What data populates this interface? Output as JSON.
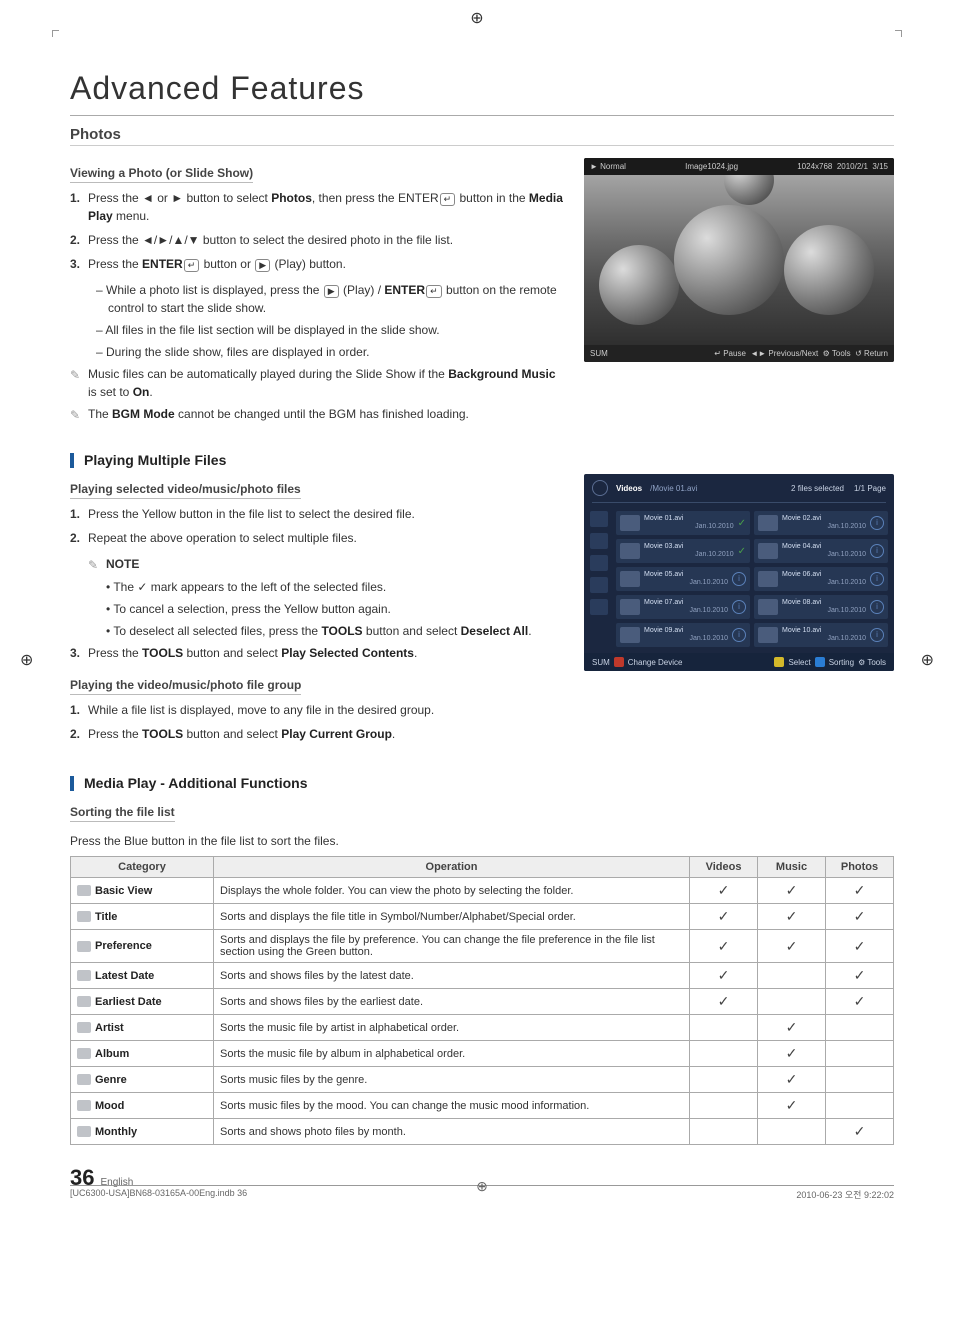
{
  "doc": {
    "title": "Advanced Features",
    "page_num": "36",
    "lang": "English",
    "footer_left": "[UC6300-USA]BN68-03165A-00Eng.indb   36",
    "footer_right": "2010-06-23   오전 9:22:02"
  },
  "photos": {
    "title": "Photos",
    "view_heading": "Viewing a Photo (or Slide Show)",
    "steps": [
      "Press the ◄ or ► button to select Photos, then press the ENTER ↵ button in the Media Play menu.",
      "Press the ◄/►/▲/▼ button to select the desired photo in the file list.",
      "Press the ENTER ↵ button or ▶ (Play) button."
    ],
    "sub": [
      "While a photo list is displayed, press the ▶ (Play) / ENTER ↵ button on the remote control to start the slide show.",
      "All files in the file list section will be displayed in the slide show.",
      "During the slide show, files are displayed in order."
    ],
    "notes": [
      "Music files can be automatically played during the Slide Show if the Background Music is set to On.",
      "The BGM Mode cannot be changed until the BGM has finished loading."
    ],
    "panel": {
      "mode": "► Normal",
      "filename": "Image1024.jpg",
      "resolution": "1024x768",
      "date": "2010/2/1",
      "index": "3/15",
      "left_label": "SUM",
      "btn_pause": "↵ Pause",
      "btn_prev": "◄► Previous/Next",
      "btn_tools": "⚙ Tools",
      "btn_return": "↺ Return"
    }
  },
  "multi": {
    "heading": "Playing Multiple Files",
    "sel_heading": "Playing selected video/music/photo files",
    "sel_steps": [
      "Press the Yellow button in the file list to select the desired file.",
      "Repeat the above operation to select multiple files."
    ],
    "note_label": "NOTE",
    "sel_notes": [
      "The ✓ mark appears to the left of the selected files.",
      "To cancel a selection, press the Yellow button again.",
      "To deselect all selected files, press the TOOLS button and select Deselect All."
    ],
    "sel_step3": "Press the TOOLS button and select Play Selected Contents.",
    "grp_heading": "Playing the video/music/photo file group",
    "grp_steps": [
      "While a file list is displayed, move to any file in the desired group.",
      "Press the TOOLS button and select Play Current Group."
    ],
    "panel": {
      "tab": "Videos",
      "path": "/Movie 01.avi",
      "selected": "2 files selected",
      "page": "1/1 Page",
      "footer_left_a": "SUM",
      "footer_left_b": "A Change Device",
      "footer_ca": "C Select",
      "footer_db": "D Sorting",
      "footer_tools": "⚙ Tools",
      "files": [
        {
          "name": "Movie 01.avi",
          "date": "Jan.10.2010",
          "checked": true
        },
        {
          "name": "Movie 02.avi",
          "date": "Jan.10.2010",
          "checked": false
        },
        {
          "name": "Movie 03.avi",
          "date": "Jan.10.2010",
          "checked": true
        },
        {
          "name": "Movie 04.avi",
          "date": "Jan.10.2010",
          "checked": false
        },
        {
          "name": "Movie 05.avi",
          "date": "Jan.10.2010",
          "checked": false
        },
        {
          "name": "Movie 06.avi",
          "date": "Jan.10.2010",
          "checked": false
        },
        {
          "name": "Movie 07.avi",
          "date": "Jan.10.2010",
          "checked": false
        },
        {
          "name": "Movie 08.avi",
          "date": "Jan.10.2010",
          "checked": false
        },
        {
          "name": "Movie 09.avi",
          "date": "Jan.10.2010",
          "checked": false
        },
        {
          "name": "Movie 10.avi",
          "date": "Jan.10.2010",
          "checked": false
        }
      ]
    }
  },
  "add": {
    "heading": "Media Play - Additional Functions",
    "sort_heading": "Sorting the file list",
    "sort_intro": "Press the Blue button in the file list to sort the files.",
    "cols": {
      "cat": "Category",
      "op": "Operation",
      "vid": "Videos",
      "mus": "Music",
      "pho": "Photos"
    },
    "rows": [
      {
        "cat": "Basic View",
        "op": "Displays the whole folder. You can view the photo by selecting the folder.",
        "v": true,
        "m": true,
        "p": true
      },
      {
        "cat": "Title",
        "op": "Sorts and displays the file title in Symbol/Number/Alphabet/Special order.",
        "v": true,
        "m": true,
        "p": true
      },
      {
        "cat": "Preference",
        "op": "Sorts and displays the file by preference. You can change the file preference in the file list section using the Green button.",
        "v": true,
        "m": true,
        "p": true
      },
      {
        "cat": "Latest Date",
        "op": "Sorts and shows files by the latest date.",
        "v": true,
        "m": false,
        "p": true
      },
      {
        "cat": "Earliest Date",
        "op": "Sorts and shows files by the earliest date.",
        "v": true,
        "m": false,
        "p": true
      },
      {
        "cat": "Artist",
        "op": "Sorts the music file by artist in alphabetical order.",
        "v": false,
        "m": true,
        "p": false
      },
      {
        "cat": "Album",
        "op": "Sorts the music file by album in alphabetical order.",
        "v": false,
        "m": true,
        "p": false
      },
      {
        "cat": "Genre",
        "op": "Sorts music files by the genre.",
        "v": false,
        "m": true,
        "p": false
      },
      {
        "cat": "Mood",
        "op": "Sorts music files by the mood. You can change the music mood information.",
        "v": false,
        "m": true,
        "p": false
      },
      {
        "cat": "Monthly",
        "op": "Sorts and shows photo files by month.",
        "v": false,
        "m": false,
        "p": true
      }
    ]
  }
}
